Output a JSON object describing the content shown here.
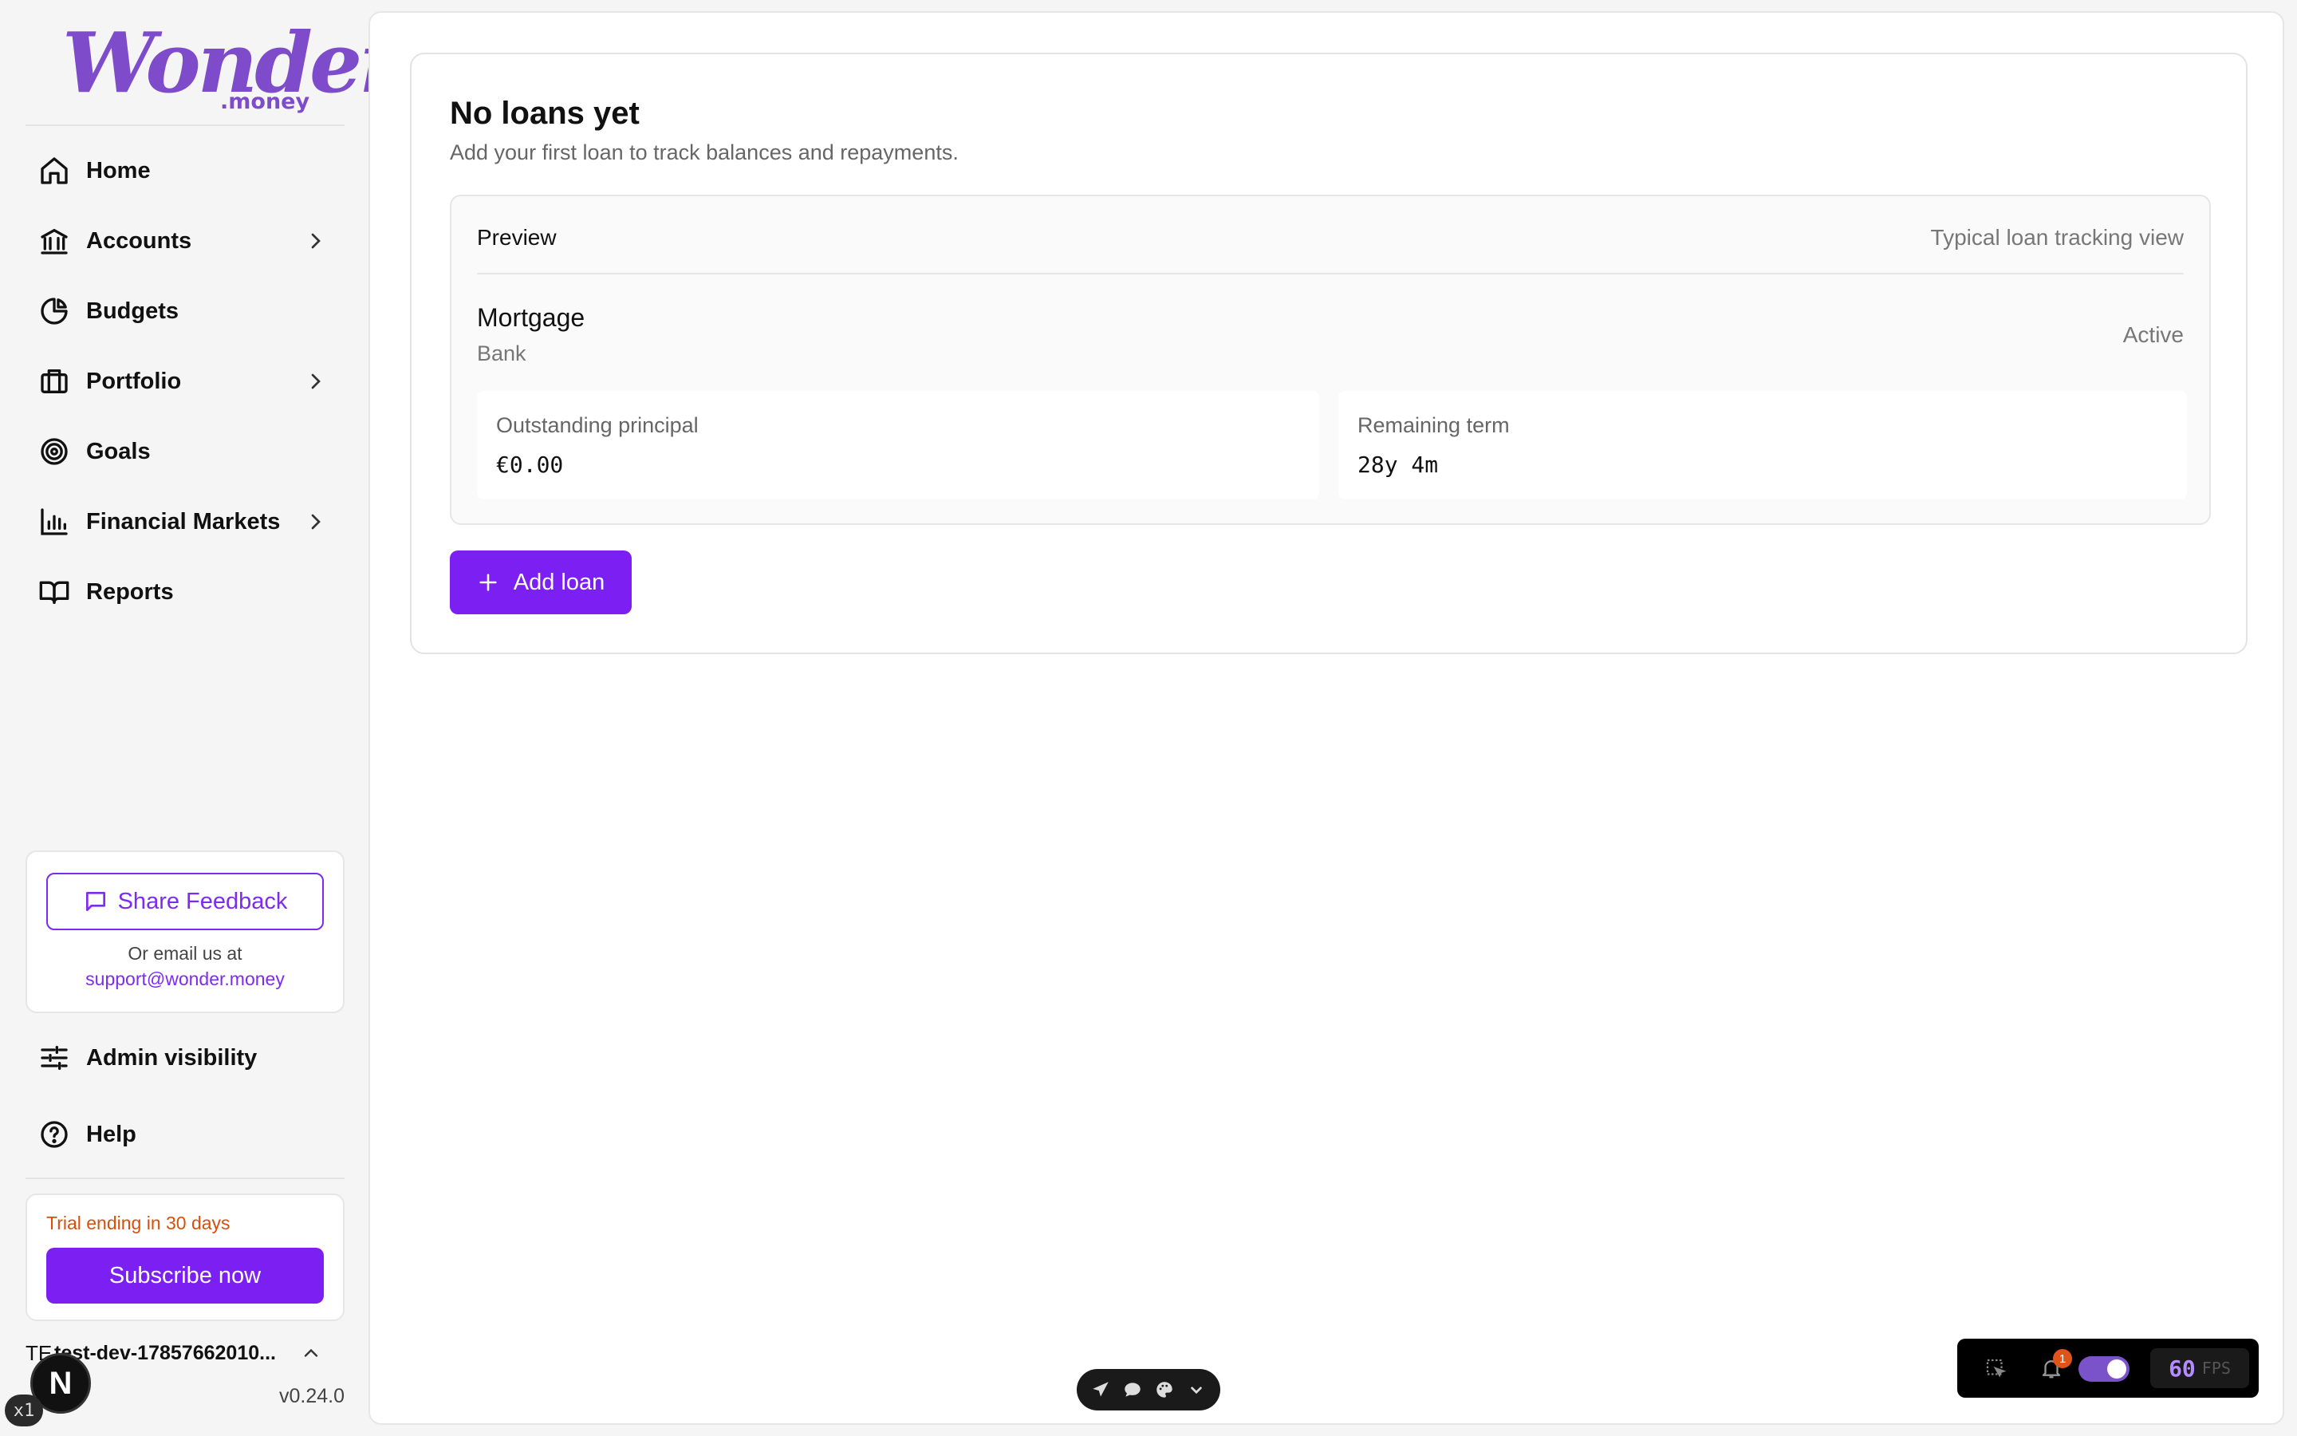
{
  "brand": {
    "name": "Wonder",
    "suffix": ".money",
    "color": "#7e4ccb"
  },
  "sidebar": {
    "items": [
      {
        "label": "Home",
        "icon": "home-icon",
        "chevron": false
      },
      {
        "label": "Accounts",
        "icon": "bank-icon",
        "chevron": true
      },
      {
        "label": "Budgets",
        "icon": "pie-chart-icon",
        "chevron": false
      },
      {
        "label": "Portfolio",
        "icon": "briefcase-icon",
        "chevron": true
      },
      {
        "label": "Goals",
        "icon": "target-icon",
        "chevron": false
      },
      {
        "label": "Financial Markets",
        "icon": "bar-chart-icon",
        "chevron": true
      },
      {
        "label": "Reports",
        "icon": "book-icon",
        "chevron": false
      }
    ],
    "feedback": {
      "button_label": "Share Feedback",
      "email_prompt": "Or email us at",
      "email": "support@wonder.money"
    },
    "admin_label": "Admin visibility",
    "help_label": "Help",
    "trial": {
      "text": "Trial ending in 30 days",
      "subscribe_label": "Subscribe now"
    },
    "user": {
      "initials": "TE",
      "name": "test-dev-17857662010..."
    },
    "version": "v0.24.0"
  },
  "main": {
    "title": "No loans yet",
    "subtitle": "Add your first loan to track balances and repayments.",
    "preview": {
      "label": "Preview",
      "right_label": "Typical loan tracking view",
      "loan": {
        "name": "Mortgage",
        "lender": "Bank",
        "status": "Active"
      },
      "stats": [
        {
          "label": "Outstanding principal",
          "value": "€0.00"
        },
        {
          "label": "Remaining term",
          "value": "28y 4m"
        }
      ]
    },
    "add_button_label": "Add loan"
  },
  "dev": {
    "next_badge": "N",
    "zoom": "x1",
    "notification_count": "1",
    "fps_value": "60",
    "fps_unit": "FPS"
  },
  "colors": {
    "accent": "#7c1ff2",
    "warning": "#d4500e"
  }
}
